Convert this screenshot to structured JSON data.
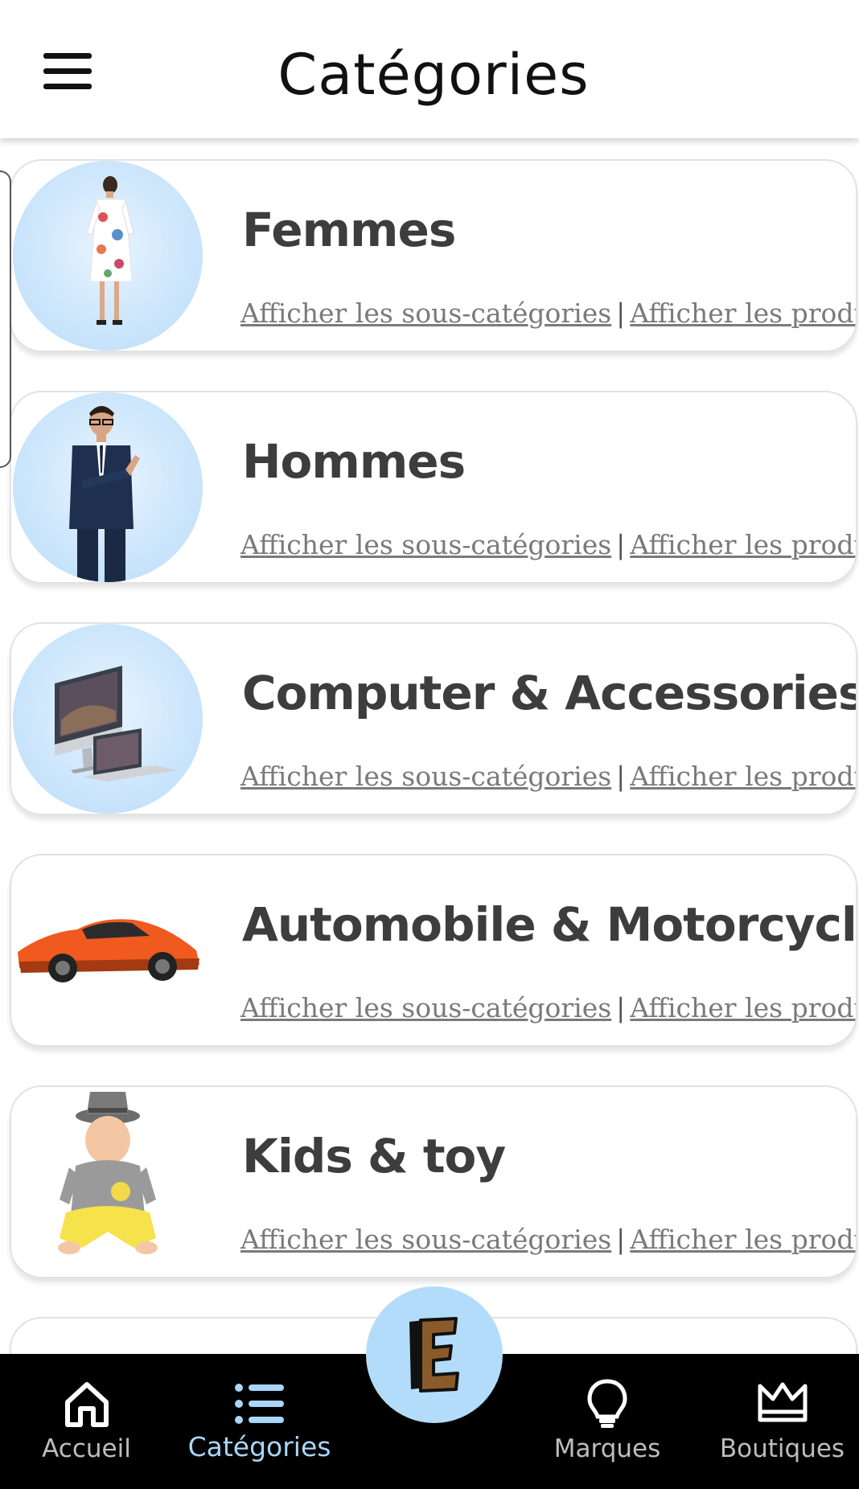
{
  "header": {
    "title": "Catégories"
  },
  "categories": [
    {
      "name": "Femmes",
      "subcat_link": "Afficher les sous-catégories",
      "separator": "|",
      "products_link": "Afficher les produits",
      "image": "woman-floral-dress"
    },
    {
      "name": "Hommes",
      "subcat_link": "Afficher les sous-catégories",
      "separator": "|",
      "products_link": "Afficher les produits",
      "image": "man-in-suit"
    },
    {
      "name": "Computer & Accessories",
      "subcat_link": "Afficher les sous-catégories",
      "separator": "|",
      "products_link": "Afficher les produits",
      "image": "imac-and-laptop"
    },
    {
      "name": "Automobile & Motorcycle",
      "subcat_link": "Afficher les sous-catégories",
      "separator": "|",
      "products_link": "Afficher les produits",
      "image": "orange-sports-car"
    },
    {
      "name": "Kids & toy",
      "subcat_link": "Afficher les sous-catégories",
      "separator": "|",
      "products_link": "Afficher les produits",
      "image": "baby-with-hat"
    }
  ],
  "bottom_nav": {
    "items": [
      {
        "label": "Accueil",
        "icon": "home-icon",
        "active": false
      },
      {
        "label": "Catégories",
        "icon": "list-icon",
        "active": true
      },
      {
        "label": "Marques",
        "icon": "lightbulb-icon",
        "active": false
      },
      {
        "label": "Boutiques",
        "icon": "crown-icon",
        "active": false
      }
    ],
    "center_button": {
      "icon": "logo-e-icon"
    }
  },
  "colors": {
    "accent": "#a9d6f7",
    "fab": "#b3dcfa",
    "nav_background": "#000000",
    "category_title": "#3d3d3d",
    "link": "#7a7a7a"
  }
}
